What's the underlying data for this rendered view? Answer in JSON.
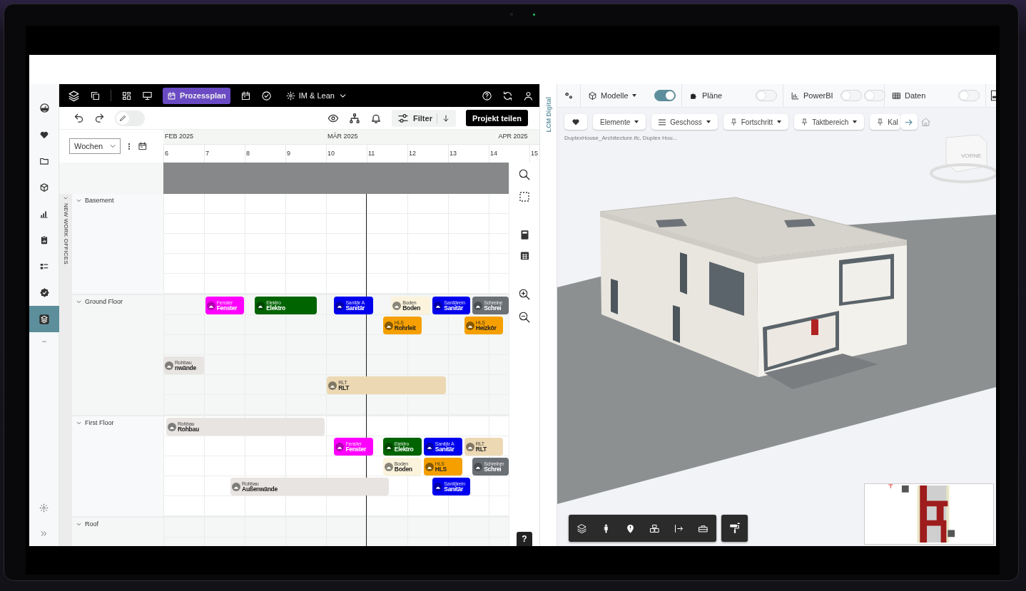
{
  "sidebar": {
    "items": [
      {
        "selected": false
      },
      {
        "selected": false
      },
      {
        "selected": false
      },
      {
        "selected": false
      },
      {
        "selected": false
      },
      {
        "selected": false
      },
      {
        "selected": false
      },
      {
        "selected": false
      },
      {
        "selected": true
      }
    ]
  },
  "toolbar": {
    "tabs": [
      {
        "label": "Prozessplan",
        "selected": true
      },
      {
        "label": "IM & Lean",
        "selected": false
      }
    ]
  },
  "actions": {
    "edit_toggle": {
      "on": false
    },
    "filter_button": "Filter",
    "share_button": "Projekt teilen"
  },
  "timeline": {
    "view_select": {
      "value": "Wochen"
    },
    "months": [
      {
        "label": "FEB 2025"
      },
      {
        "label": "MÄR 2025"
      },
      {
        "label": "APR 2025"
      }
    ],
    "weeks": [
      "6",
      "7",
      "8",
      "9",
      "10",
      "11",
      "12",
      "13",
      "14",
      "15"
    ]
  },
  "project": {
    "label": "NEW WORK OFFICES",
    "expanded": true
  },
  "floors": [
    {
      "name": "Basement",
      "expanded": true
    },
    {
      "name": "Ground Floor",
      "expanded": true,
      "tasks": [
        {
          "category": "Fenster",
          "title": "Fenster",
          "color": "#ff00ff"
        },
        {
          "category": "Elektro",
          "title": "Elektro",
          "color": "#006400"
        },
        {
          "category": "Sanitär A",
          "title": "Sanitär",
          "color": "#0000ee"
        },
        {
          "category": "Boden",
          "title": "Boden",
          "color": "#fbf3dc"
        },
        {
          "category": "Sanitärein",
          "title": "Sanitär",
          "color": "#0000ee"
        },
        {
          "category": "Schreine",
          "title": "Schrei",
          "color": "#6b7075"
        },
        {
          "category": "HLS",
          "title": "Rohrleit",
          "color": "#f5a000"
        },
        {
          "category": "HLS",
          "title": "Heizkör",
          "color": "#f5a000"
        },
        {
          "category": "Rohbau",
          "title": "nwände",
          "color": "#e8e4e2"
        },
        {
          "category": "RLT",
          "title": "RLT",
          "color": "#ecd9b4"
        }
      ]
    },
    {
      "name": "First Floor",
      "expanded": true,
      "tasks": [
        {
          "category": "Rohbau",
          "title": "Rohbau",
          "color": "#e8e4e2"
        },
        {
          "category": "Fenster",
          "title": "Fenster",
          "color": "#ff00ff"
        },
        {
          "category": "Elektro",
          "title": "Elektro",
          "color": "#006400"
        },
        {
          "category": "Sanitär A",
          "title": "Sanitär",
          "color": "#0000ee"
        },
        {
          "category": "RLT",
          "title": "RLT",
          "color": "#ecd9b4"
        },
        {
          "category": "Boden",
          "title": "Boden",
          "color": "#fbf3dc"
        },
        {
          "category": "HLS",
          "title": "HLS",
          "color": "#f5a000"
        },
        {
          "category": "Schreiner",
          "title": "Schrei",
          "color": "#6b7075"
        },
        {
          "category": "Rohbau",
          "title": "Außenwände",
          "color": "#e8e4e2"
        },
        {
          "category": "Sanitärein",
          "title": "Sanitär",
          "color": "#0000ee"
        }
      ]
    },
    {
      "name": "Roof",
      "expanded": true
    }
  ],
  "help_button": "?",
  "viewer": {
    "side_label": "LCM Digital",
    "panels": [
      {
        "label": "Modelle",
        "kind": "dropdown",
        "toggles": [
          {
            "on": true
          }
        ]
      },
      {
        "label": "Pläne",
        "kind": "plain",
        "toggles": [
          {
            "on": false
          }
        ]
      },
      {
        "label": "PowerBI",
        "kind": "plain",
        "toggles": [
          {
            "on": false
          },
          {
            "on": false
          }
        ]
      },
      {
        "label": "Daten",
        "kind": "plain",
        "toggles": [
          {
            "on": false
          }
        ]
      }
    ],
    "filters": [
      {
        "label": "Elemente",
        "kind": "dropdown"
      },
      {
        "label": "Geschoss",
        "kind": "list"
      },
      {
        "label": "Fortschritt",
        "kind": "pin"
      },
      {
        "label": "Taktbereich",
        "kind": "pin"
      },
      {
        "label": "Kal",
        "kind": "pin-cut"
      }
    ],
    "model_files": "DuplexHouse_Architecture.ifc, Duplex Hou...",
    "view_cube": {
      "label": "VORNE"
    }
  }
}
